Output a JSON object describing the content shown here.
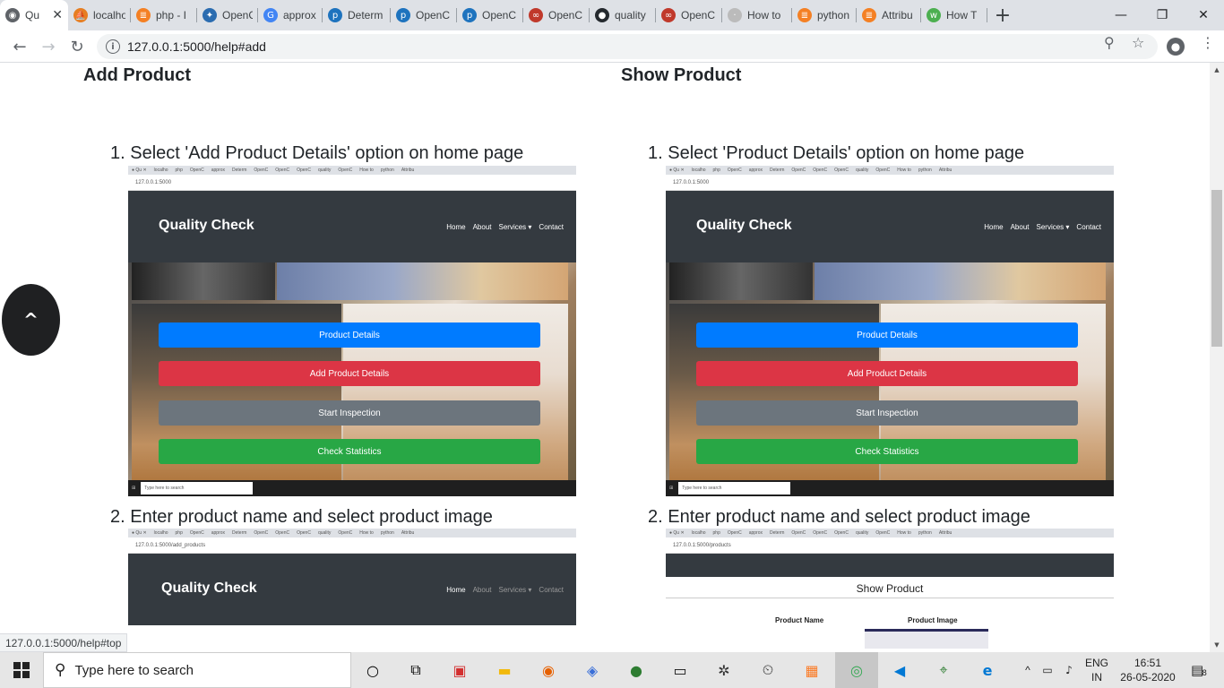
{
  "browser": {
    "tabs": [
      {
        "label": "Qu",
        "icon": "chrome-icon",
        "color": "#5f6368",
        "active": true
      },
      {
        "label": "localho",
        "icon": "phpmyadmin-icon",
        "color": "#e67e22"
      },
      {
        "label": "php - I",
        "icon": "stackoverflow-icon",
        "color": "#f48024"
      },
      {
        "label": "OpenC",
        "icon": "tensor-icon",
        "color": "#2b6cb0"
      },
      {
        "label": "approx",
        "icon": "google-icon",
        "color": "#4285f4"
      },
      {
        "label": "Determ",
        "icon": "pyimagesearch-icon",
        "color": "#1e73be"
      },
      {
        "label": "OpenC",
        "icon": "pyimagesearch-icon",
        "color": "#1e73be"
      },
      {
        "label": "OpenC",
        "icon": "pyimagesearch-icon",
        "color": "#1e73be"
      },
      {
        "label": "OpenC",
        "icon": "opencv-icon",
        "color": "#c0392b"
      },
      {
        "label": "quality",
        "icon": "github-icon",
        "color": "#24292e"
      },
      {
        "label": "OpenC",
        "icon": "opencv-icon",
        "color": "#c0392b"
      },
      {
        "label": "How to",
        "icon": "page-icon",
        "color": "#bbbbbb"
      },
      {
        "label": "python",
        "icon": "stackoverflow-icon",
        "color": "#f48024"
      },
      {
        "label": "Attribu",
        "icon": "stackoverflow-icon",
        "color": "#f48024"
      },
      {
        "label": "How T",
        "icon": "w3schools-icon",
        "color": "#4caf50"
      }
    ],
    "new_tab": "+",
    "window_controls": {
      "minimize": "—",
      "restore": "❐",
      "close": "✕"
    },
    "url": "127.0.0.1:5000/help#add",
    "status_url": "127.0.0.1:5000/help#top"
  },
  "page": {
    "left": {
      "heading": "Add Product",
      "step1": "1. Select 'Add Product Details' option on home page",
      "step2": "2. Enter product name and select product image"
    },
    "right": {
      "heading": "Show Product",
      "step1": "1. Select 'Product Details' option on home page",
      "step2": "2. Enter product name and select product image"
    },
    "scroll_top": "^"
  },
  "shots": {
    "home_url": "127.0.0.1:5000",
    "add_url": "127.0.0.1:5000/add_products",
    "products_url": "127.0.0.1:5000/products",
    "brand": "Quality Check",
    "nav": [
      "Home",
      "About",
      "Services ▾",
      "Contact"
    ],
    "buttons": [
      {
        "label": "Product Details",
        "color": "#007bff"
      },
      {
        "label": "Add Product Details",
        "color": "#dc3545"
      },
      {
        "label": "Start Inspection",
        "color": "#6c757d"
      },
      {
        "label": "Check Statistics",
        "color": "#28a745"
      }
    ],
    "taskbar_search": "Type here to search",
    "show_title": "Show Product",
    "col_name": "Product Name",
    "col_image": "Product Image"
  },
  "taskbar": {
    "search_placeholder": "Type here to search",
    "lang": "ENG",
    "region": "IN",
    "time": "16:51",
    "date": "26-05-2020",
    "notifications": "8"
  }
}
